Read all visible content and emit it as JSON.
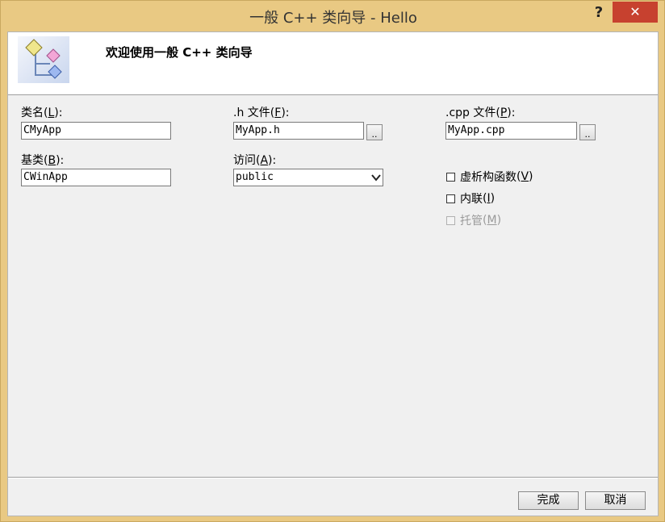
{
  "window": {
    "title": "一般 C++ 类向导 - Hello",
    "help_glyph": "?",
    "close_glyph": "✕"
  },
  "header": {
    "text": "欢迎使用一般 C++ 类向导"
  },
  "form": {
    "class_name": {
      "label": "类名",
      "hotkey": "L",
      "value": "CMyApp"
    },
    "h_file": {
      "label": ".h 文件",
      "hotkey": "F",
      "value": "MyApp.h",
      "browse": ".."
    },
    "cpp_file": {
      "label": ".cpp 文件",
      "hotkey": "P",
      "value": "MyApp.cpp",
      "browse": ".."
    },
    "base_class": {
      "label": "基类",
      "hotkey": "B",
      "value": "CWinApp"
    },
    "access": {
      "label": "访问",
      "hotkey": "A",
      "selected": "public"
    }
  },
  "options": [
    {
      "label": "虚析构函数",
      "hotkey": "V",
      "checked": false,
      "disabled": false
    },
    {
      "label": "内联",
      "hotkey": "I",
      "checked": false,
      "disabled": false
    },
    {
      "label": "托管",
      "hotkey": "M",
      "checked": false,
      "disabled": true
    }
  ],
  "buttons": {
    "finish": "完成",
    "cancel": "取消"
  },
  "icons": {
    "logo": "class-wizard-icon",
    "browse": "ellipsis-icon",
    "dropdown": "chevron-down-icon"
  },
  "colors": {
    "frame": "#e9c983",
    "close_button": "#c7412f",
    "client_bg": "#f0f0f0",
    "header_bg": "#ffffff"
  }
}
